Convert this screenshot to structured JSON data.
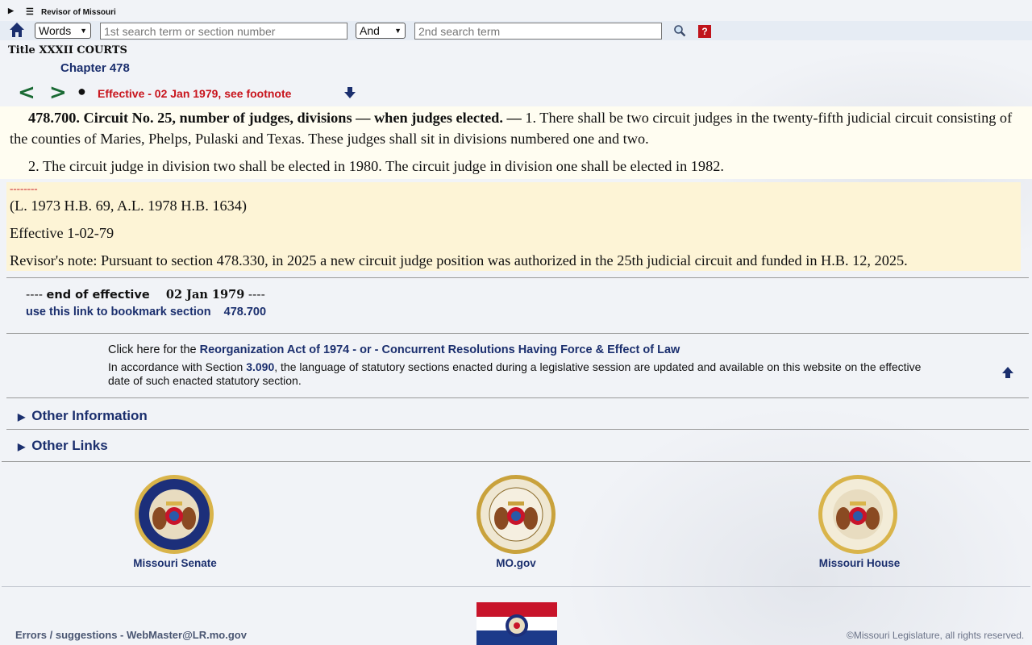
{
  "topbar": {
    "site_title": "Revisor of Missouri"
  },
  "search": {
    "mode_selected": "Words",
    "term1_placeholder": "1st search term or section number",
    "operator_selected": "And",
    "term2_placeholder": "2nd search term"
  },
  "breadcrumb": {
    "title": "Title XXXII COURTS",
    "chapter": "Chapter 478"
  },
  "nav": {
    "prev": "<",
    "next": ">",
    "bullet": "●",
    "effective": "Effective - 02 Jan 1979, see footnote"
  },
  "statute": {
    "heading": "478.700.  Circuit No. 25, number of judges, divisions — when judges elected. —",
    "p1": " 1.  There shall be two circuit judges in the twenty-fifth judicial circuit consisting of the counties of Maries, Phelps, Pulaski and Texas.  These judges shall sit in divisions numbered one and two.",
    "p2": "2.  The circuit judge in division two shall be elected in 1980.  The circuit judge in division one shall be elected in 1982."
  },
  "history": {
    "dashes": "--------",
    "source": "(L. 1973 H.B. 69, A.L. 1978 H.B. 1634)",
    "effective": "Effective 1-02-79",
    "note": "Revisor's note:  Pursuant to section 478.330, in 2025 a new circuit judge position was authorized in the 25th judicial circuit and funded in H.B. 12, 2025."
  },
  "end_of_effective": {
    "prefix": "---- ",
    "label": "end of effective",
    "date": "02 Jan 1979",
    "suffix": " ----"
  },
  "bookmark": {
    "label": "use this link to bookmark section",
    "section": "478.700"
  },
  "info": {
    "click_prefix": "Click here for the ",
    "reorg_link": "Reorganization Act of 1974",
    "or": " - or - ",
    "concurrent_link": "Concurrent Resolutions Having Force & Effect of Law",
    "accordance_prefix": "In accordance with Section ",
    "section_link": "3.090",
    "accordance_rest": ", the language of statutory sections enacted during a legislative session are updated and available on this website on the effective date of such enacted statutory section."
  },
  "details": {
    "other_information": "Other Information",
    "other_links": "Other Links"
  },
  "seals": {
    "senate": "Missouri Senate",
    "mogov": "MO.gov",
    "house": "Missouri House"
  },
  "footer": {
    "errors": "Errors / suggestions - WebMaster@LR.mo.gov",
    "copyright": "©Missouri Legislature, all rights reserved."
  },
  "colors": {
    "link": "#1b2f6e",
    "effective_red": "#c8141c",
    "statute_bg": "#fffdf1",
    "history_bg": "#fdf4d6",
    "nav_arrow": "#1a6a34"
  }
}
